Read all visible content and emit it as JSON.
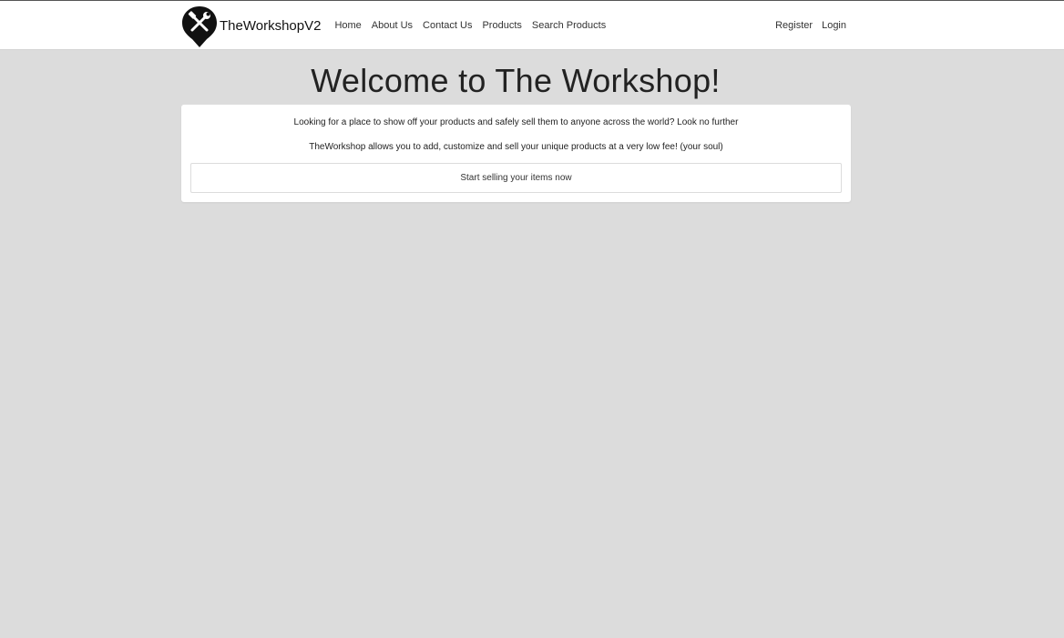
{
  "nav": {
    "brand_name": "TheWorkshopV2",
    "brand_icon": "wrench-hammer-pin-icon",
    "links": [
      {
        "label": "Home"
      },
      {
        "label": "About Us"
      },
      {
        "label": "Contact Us"
      },
      {
        "label": "Products"
      },
      {
        "label": "Search Products"
      }
    ],
    "right_links": [
      {
        "label": "Register"
      },
      {
        "label": "Login"
      }
    ]
  },
  "hero": {
    "title": "Welcome to The Workshop!",
    "line1": "Looking for a place to show off your products and safely sell them to anyone across the world? Look no further",
    "line2": "TheWorkshop allows you to add, customize and sell your unique products at a very low fee! (your soul)",
    "cta_label": "Start selling your items now"
  },
  "colors": {
    "background": "#dcdcdc",
    "navbar": "#ffffff",
    "card": "#ffffff"
  }
}
